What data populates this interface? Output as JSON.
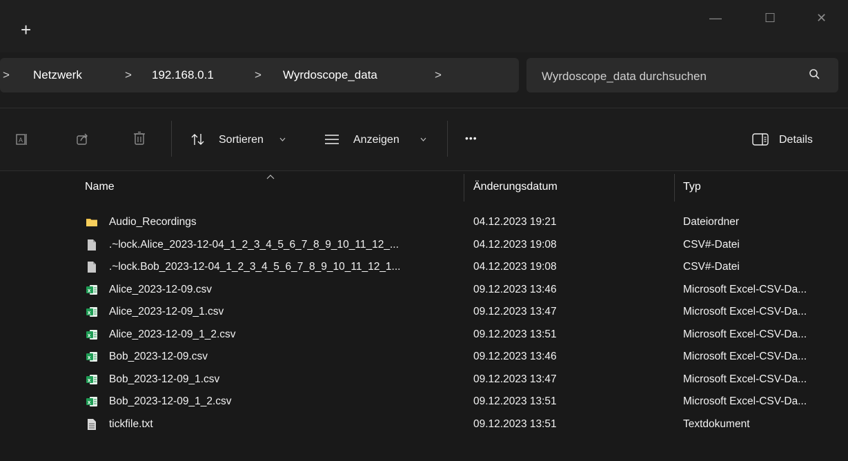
{
  "titlebar": {
    "newtab_glyph": "+",
    "min_glyph": "—",
    "max_glyph": "☐",
    "close_glyph": "✕"
  },
  "breadcrumb": {
    "leading_chevron": ">",
    "items": [
      "Netzwerk",
      "192.168.0.1",
      "Wyrdoscope_data"
    ],
    "separator": ">"
  },
  "search": {
    "placeholder": "Wyrdoscope_data durchsuchen"
  },
  "toolbar": {
    "sort_label": "Sortieren",
    "view_label": "Anzeigen",
    "more_label": "•••",
    "details_label": "Details",
    "icons": [
      "rename-icon",
      "share-icon",
      "delete-icon",
      "sort-icon",
      "view-icon",
      "details-icon"
    ]
  },
  "columns": {
    "name": "Name",
    "date": "Änderungsdatum",
    "type": "Typ"
  },
  "files": [
    {
      "icon": "folder-icon",
      "name": "Audio_Recordings",
      "date": "04.12.2023 19:21",
      "type": "Dateiordner"
    },
    {
      "icon": "file-icon",
      "name": ".~lock.Alice_2023-12-04_1_2_3_4_5_6_7_8_9_10_11_12_...",
      "date": "04.12.2023 19:08",
      "type": "CSV#-Datei"
    },
    {
      "icon": "file-icon",
      "name": ".~lock.Bob_2023-12-04_1_2_3_4_5_6_7_8_9_10_11_12_1...",
      "date": "04.12.2023 19:08",
      "type": "CSV#-Datei"
    },
    {
      "icon": "excel-icon",
      "name": "Alice_2023-12-09.csv",
      "date": "09.12.2023 13:46",
      "type": "Microsoft Excel-CSV-Da..."
    },
    {
      "icon": "excel-icon",
      "name": "Alice_2023-12-09_1.csv",
      "date": "09.12.2023 13:47",
      "type": "Microsoft Excel-CSV-Da..."
    },
    {
      "icon": "excel-icon",
      "name": "Alice_2023-12-09_1_2.csv",
      "date": "09.12.2023 13:51",
      "type": "Microsoft Excel-CSV-Da..."
    },
    {
      "icon": "excel-icon",
      "name": "Bob_2023-12-09.csv",
      "date": "09.12.2023 13:46",
      "type": "Microsoft Excel-CSV-Da..."
    },
    {
      "icon": "excel-icon",
      "name": "Bob_2023-12-09_1.csv",
      "date": "09.12.2023 13:47",
      "type": "Microsoft Excel-CSV-Da..."
    },
    {
      "icon": "excel-icon",
      "name": "Bob_2023-12-09_1_2.csv",
      "date": "09.12.2023 13:51",
      "type": "Microsoft Excel-CSV-Da..."
    },
    {
      "icon": "text-file-icon",
      "name": "tickfile.txt",
      "date": "09.12.2023 13:51",
      "type": "Textdokument"
    }
  ],
  "colors": {
    "folder": "#f3c44b",
    "excel": "#1f9d55",
    "file": "#c8c8c8",
    "background": "#191919"
  }
}
